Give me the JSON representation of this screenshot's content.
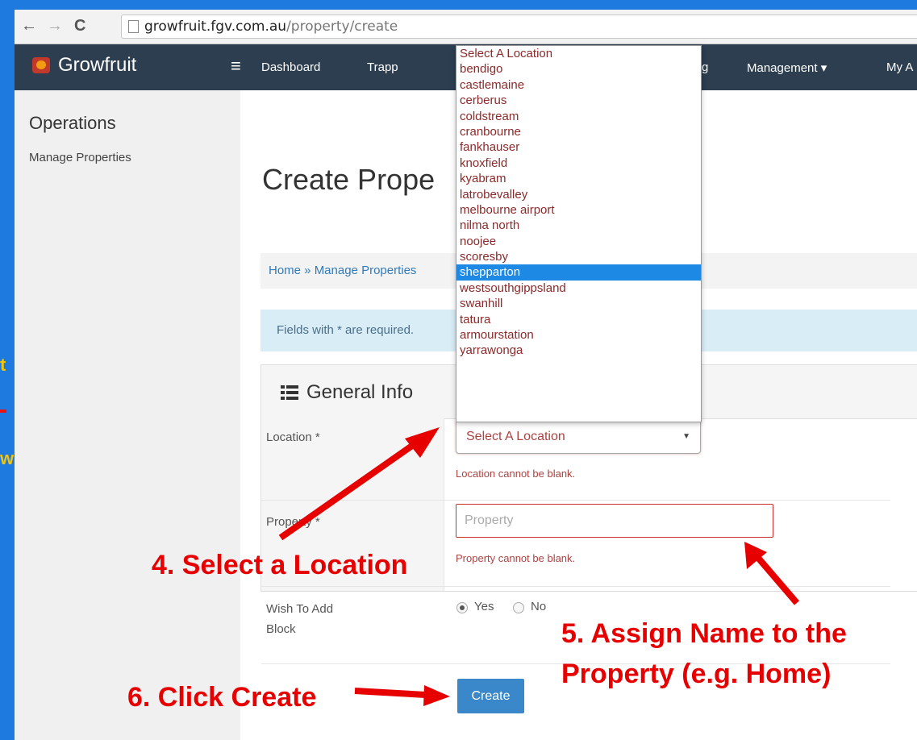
{
  "browser": {
    "back_icon": "back-arrow-icon",
    "forward_icon": "forward-arrow-icon",
    "reload_icon": "reload-icon",
    "url_host": "growfruit.fgv.com.au",
    "url_path": "/property/create"
  },
  "navbar": {
    "brand": "Growfruit",
    "items": [
      "Dashboard",
      "Trapp",
      "g",
      "Management ▾",
      "My A"
    ]
  },
  "sidebar": {
    "title": "Operations",
    "link": "Manage Properties"
  },
  "page": {
    "title": "Create Prope",
    "breadcrumb": "Home » Manage Properties",
    "required_note": "Fields with * are required."
  },
  "form": {
    "panel_title": "General Info",
    "location_label": "Location *",
    "location_value": "Select A Location",
    "location_error": "Location cannot be blank.",
    "property_label": "Property *",
    "property_placeholder": "Property",
    "property_error": "Property cannot be blank.",
    "block_label_1": "Wish To Add",
    "block_label_2": "Block",
    "yes_label": "Yes",
    "no_label": "No",
    "yes_selected": true,
    "create_label": "Create"
  },
  "dropdown": {
    "options": [
      "Select A Location",
      "bendigo",
      "castlemaine",
      "cerberus",
      "coldstream",
      "cranbourne",
      "fankhauser",
      "knoxfield",
      "kyabram",
      "latrobevalley",
      "melbourne airport",
      "nilma north",
      "noojee",
      "scoresby",
      "shepparton",
      "westsouthgippsland",
      "swanhill",
      "tatura",
      "armourstation",
      "yarrawonga"
    ],
    "highlighted": "shepparton"
  },
  "annotations": {
    "step4": "4. Select a Location",
    "step5_line1": "5. Assign Name to the",
    "step5_line2": "Property (e.g. Home)",
    "step6": "6. Click Create"
  },
  "strip_fragments": [
    "t",
    "w"
  ],
  "colors": {
    "frame_blue": "#1f7ae0",
    "navbar": "#2c3e50",
    "annotation_red": "#e60000",
    "highlight_blue": "#1e88e5",
    "error_red": "#a94442"
  }
}
